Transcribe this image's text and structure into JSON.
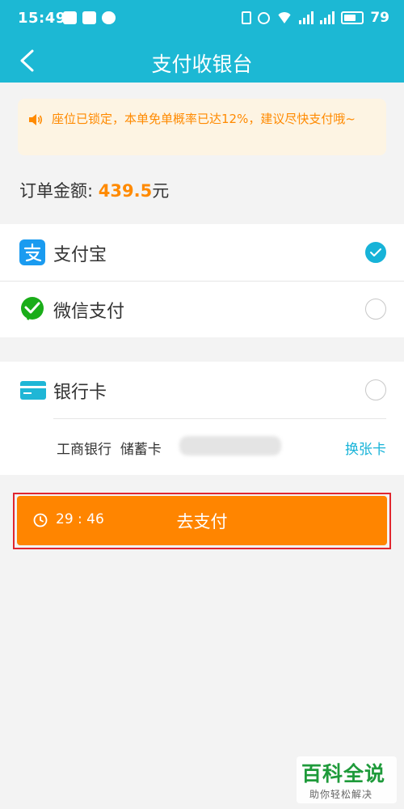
{
  "status_bar": {
    "time": "15:49",
    "battery": "79"
  },
  "header": {
    "title": "支付收银台"
  },
  "notice": {
    "text": "座位已锁定，本单免单概率已达12%，建议尽快支付哦~"
  },
  "order": {
    "label": "订单金额: ",
    "amount": "439.5",
    "unit": "元"
  },
  "payment_methods": [
    {
      "label": "支付宝",
      "selected": true,
      "icon": "alipay-icon"
    },
    {
      "label": "微信支付",
      "selected": false,
      "icon": "wechat-pay-icon"
    },
    {
      "label": "银行卡",
      "selected": false,
      "icon": "bank-card-icon"
    }
  ],
  "bank_card": {
    "bank": "工商银行",
    "type": "储蓄卡",
    "change_label": "换张卡"
  },
  "pay_button": {
    "countdown": "29 : 46",
    "label": "去支付"
  },
  "watermark": {
    "title": "百科全说",
    "subtitle": "助你轻松解决"
  },
  "colors": {
    "primary": "#1cb8d4",
    "accent": "#ff8500",
    "notice_bg": "#fdf4e3",
    "check": "#17b3d8"
  }
}
